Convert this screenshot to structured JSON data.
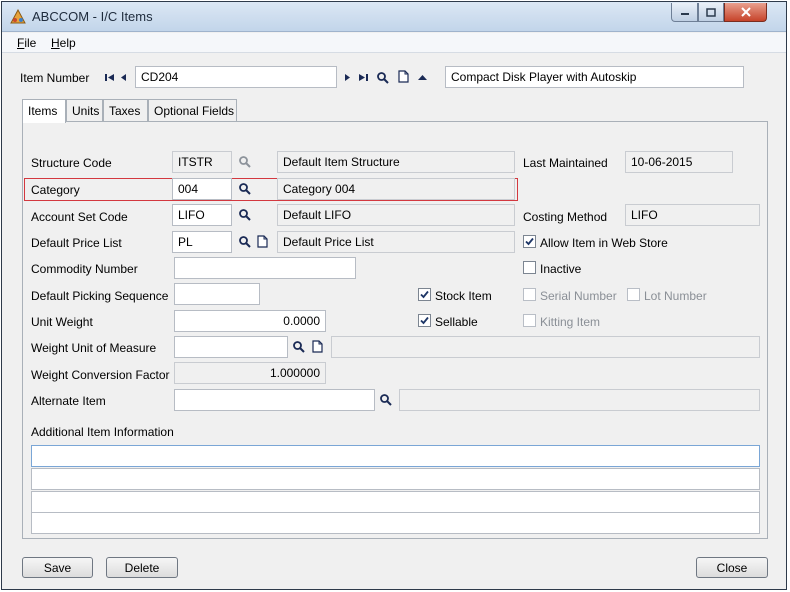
{
  "window": {
    "title": "ABCCOM - I/C Items"
  },
  "menu": [
    "File",
    "Help"
  ],
  "item_number": {
    "label": "Item Number",
    "value": "CD204",
    "description": "Compact Disk Player with Autoskip"
  },
  "tabs": [
    "Items",
    "Units",
    "Taxes",
    "Optional Fields"
  ],
  "fields": {
    "structure_code": {
      "label": "Structure Code",
      "value": "ITSTR",
      "description": "Default Item Structure"
    },
    "category": {
      "label": "Category",
      "value": "004",
      "description": "Category 004"
    },
    "account_set_code": {
      "label": "Account Set Code",
      "value": "LIFO",
      "description": "Default LIFO"
    },
    "default_price_list": {
      "label": "Default Price List",
      "value": "PL",
      "description": "Default Price List"
    },
    "commodity_number": {
      "label": "Commodity Number",
      "value": ""
    },
    "default_picking_sequence": {
      "label": "Default Picking Sequence",
      "value": ""
    },
    "unit_weight": {
      "label": "Unit Weight",
      "value": "0.0000"
    },
    "weight_unit_of_measure": {
      "label": "Weight Unit of Measure",
      "value": ""
    },
    "weight_conversion_factor": {
      "label": "Weight Conversion Factor",
      "value": "1.000000"
    },
    "alternate_item": {
      "label": "Alternate Item",
      "value": ""
    },
    "additional_item_information": {
      "label": "Additional Item Information",
      "lines": [
        "",
        "",
        "",
        ""
      ]
    }
  },
  "right": {
    "last_maintained": {
      "label": "Last Maintained",
      "value": "10-06-2015"
    },
    "costing_method": {
      "label": "Costing Method",
      "value": "LIFO"
    }
  },
  "checkboxes": {
    "allow_web_store": {
      "label": "Allow Item in Web Store",
      "checked": true
    },
    "inactive": {
      "label": "Inactive",
      "checked": false
    },
    "stock_item": {
      "label": "Stock Item",
      "checked": true
    },
    "serial_number": {
      "label": "Serial Number",
      "checked": false
    },
    "lot_number": {
      "label": "Lot Number",
      "checked": false
    },
    "sellable": {
      "label": "Sellable",
      "checked": true
    },
    "kitting_item": {
      "label": "Kitting Item",
      "checked": false
    }
  },
  "buttons": {
    "save": "Save",
    "delete": "Delete",
    "close": "Close"
  },
  "colors": {
    "highlight": "#d3383f",
    "titlebar": "#c2d5ea",
    "face": "#f0f0f0"
  },
  "icons": {
    "finder": "magnifier-icon",
    "new": "new-document-icon",
    "nav_first": "first-record-icon",
    "nav_prev": "previous-record-icon",
    "nav_next": "next-record-icon",
    "nav_last": "last-record-icon",
    "zoom": "zoom-up-icon"
  }
}
